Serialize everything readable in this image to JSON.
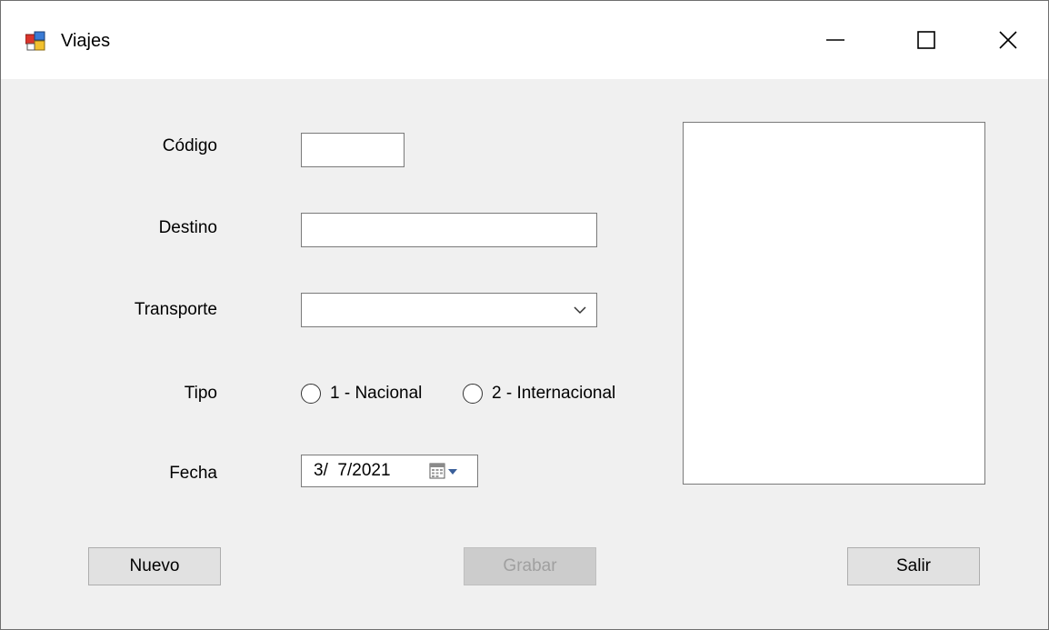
{
  "window": {
    "title": "Viajes"
  },
  "form": {
    "codigo_label": "Código",
    "codigo_value": "",
    "destino_label": "Destino",
    "destino_value": "",
    "transporte_label": "Transporte",
    "transporte_value": "",
    "tipo_label": "Tipo",
    "tipo_options": [
      "1 - Nacional",
      "2 - Internacional"
    ],
    "fecha_label": "Fecha",
    "fecha_value": "3/  7/2021"
  },
  "buttons": {
    "nuevo": "Nuevo",
    "grabar": "Grabar",
    "salir": "Salir"
  },
  "colors": {
    "form_background": "#f0f0f0",
    "disabled_text": "#a0a0a0"
  },
  "icons": {
    "app": "app-window-icon",
    "minimize": "minimize-icon",
    "maximize": "maximize-icon",
    "close": "close-icon",
    "dropdown": "chevron-down-icon",
    "calendar": "calendar-icon"
  }
}
